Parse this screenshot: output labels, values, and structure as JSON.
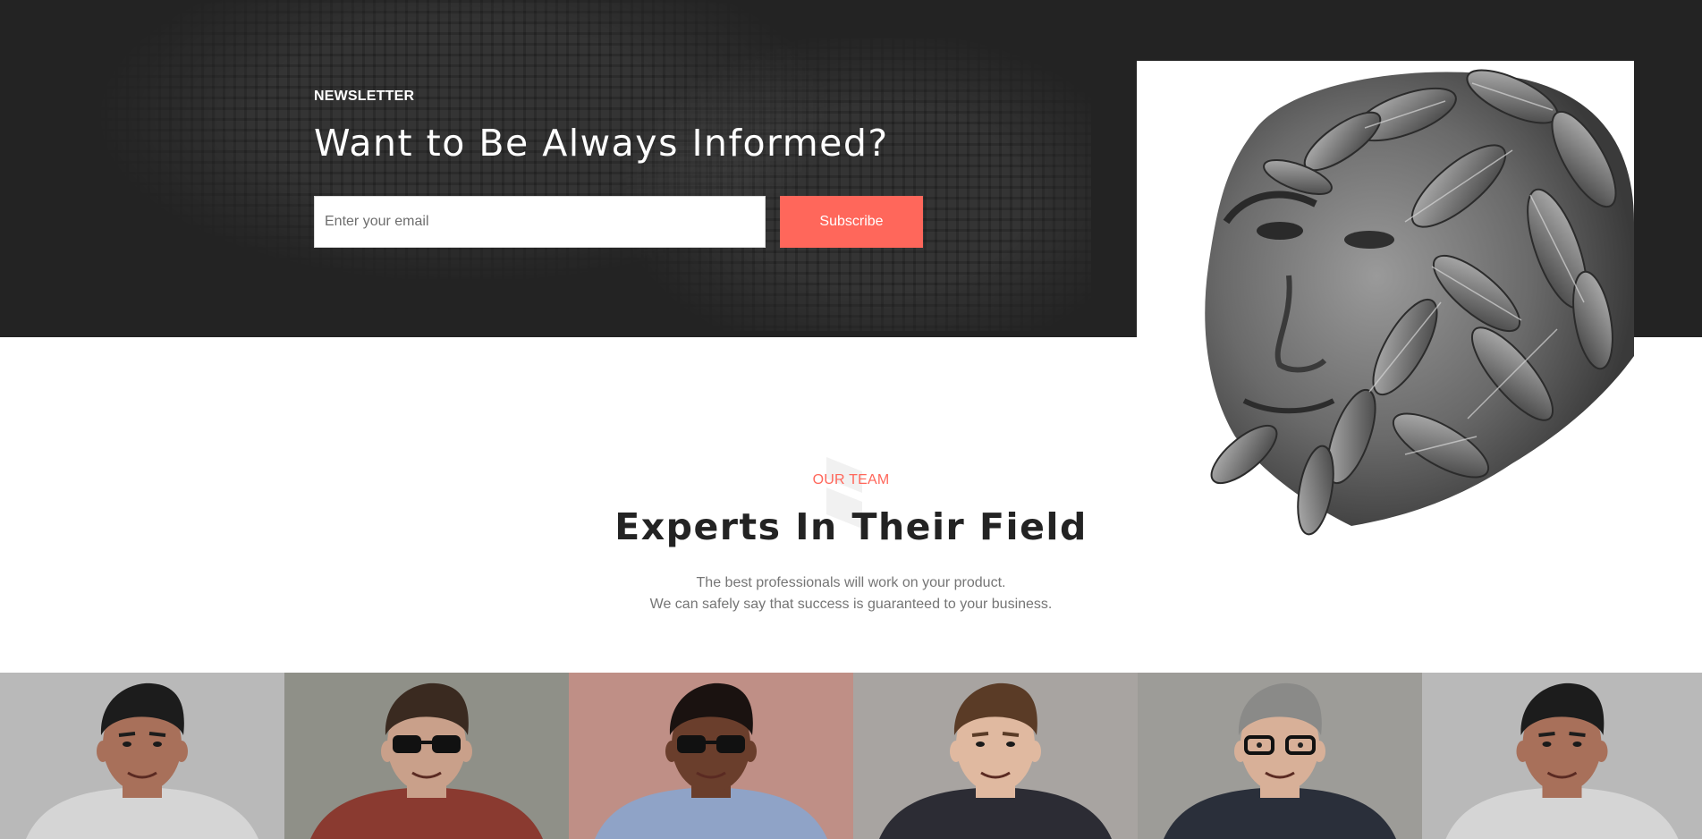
{
  "newsletter": {
    "label": "NEWSLETTER",
    "title": "Want to Be Always Informed?",
    "email_placeholder": "Enter your email",
    "email_value": "",
    "subscribe_label": "Subscribe"
  },
  "team": {
    "eyebrow": "OUR TEAM",
    "title": "Experts In Their Field",
    "description_line_1": "The best professionals will work on your product.",
    "description_line_2": "We can safely say that success is guaranteed to your business."
  },
  "team_members": [
    {
      "backdrop": "#b9b9b9",
      "skin": "#a8705a",
      "hair": "#1c1c1c",
      "shirt": "#d5d5d5",
      "accessory": "none"
    },
    {
      "backdrop": "#8f9088",
      "skin": "#c9a08a",
      "hair": "#3a2a20",
      "shirt": "#8a3a30",
      "accessory": "sunglasses"
    },
    {
      "backdrop": "#bf8f86",
      "skin": "#6a3e2c",
      "hair": "#1a1210",
      "shirt": "#8fa3c7",
      "accessory": "sunglasses"
    },
    {
      "backdrop": "#a8a4a1",
      "skin": "#e0b9a0",
      "hair": "#5a3b26",
      "shirt": "#2c2c34",
      "accessory": "none"
    },
    {
      "backdrop": "#9d9c98",
      "skin": "#d8b098",
      "hair": "#8a8a88",
      "shirt": "#2a2f3a",
      "accessory": "glasses"
    },
    {
      "backdrop": "#b9b9b9",
      "skin": "#a8705a",
      "hair": "#1c1c1c",
      "shirt": "#d5d5d5",
      "accessory": "none"
    }
  ],
  "colors": {
    "accent": "#ff675b",
    "dark_band": "#232323",
    "heading": "#232323",
    "body_text": "#757575"
  }
}
